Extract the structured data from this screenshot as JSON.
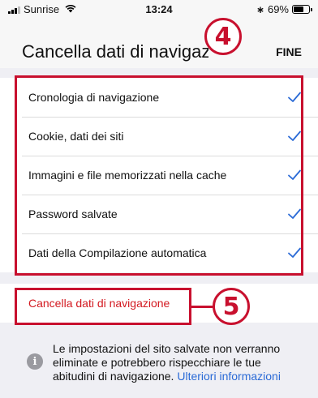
{
  "status_bar": {
    "carrier": "Sunrise",
    "time": "13:24",
    "battery": "69%",
    "battery_level": 0.69,
    "icons": [
      "signal-icon",
      "wifi-icon",
      "bluetooth-icon",
      "battery-icon"
    ]
  },
  "header": {
    "title": "Cancella dati di navigazione",
    "done_label": "FINE"
  },
  "options": [
    {
      "label": "Cronologia di navigazione",
      "checked": true
    },
    {
      "label": "Cookie, dati dei siti",
      "checked": true
    },
    {
      "label": "Immagini e file memorizzati nella cache",
      "checked": true
    },
    {
      "label": "Password salvate",
      "checked": true
    },
    {
      "label": "Dati della Compilazione automatica",
      "checked": true
    }
  ],
  "action": {
    "label": "Cancella dati di navigazione"
  },
  "info": {
    "text": "Le impostazioni del sito salvate non verranno eliminate e potrebbero rispecchiare le tue abitudini di navigazione. ",
    "link": "Ulteriori informazioni"
  },
  "callouts": [
    {
      "number": "4"
    },
    {
      "number": "5"
    }
  ],
  "colors": {
    "accent": "#2a6ad6",
    "danger": "#d31920",
    "callout": "#c8102e"
  }
}
